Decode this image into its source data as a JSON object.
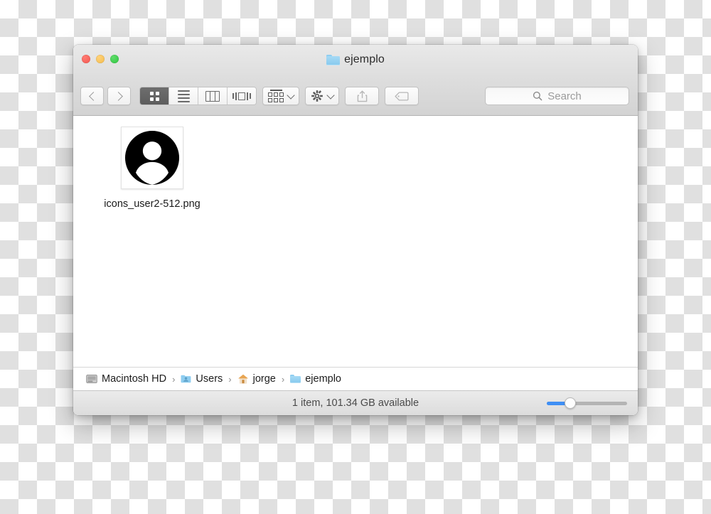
{
  "window": {
    "title": "ejemplo",
    "title_icon": "folder-icon",
    "traffic_lights": [
      {
        "name": "close",
        "label": "Close",
        "color": "#f35750"
      },
      {
        "name": "minimize",
        "label": "Minimize",
        "color": "#f3bb4b"
      },
      {
        "name": "maximize",
        "label": "Maximize",
        "color": "#2fc640"
      }
    ]
  },
  "toolbar": {
    "back_label": "Back",
    "back_icon": "chevron-left-icon",
    "forward_label": "Forward",
    "forward_icon": "chevron-right-icon",
    "view_modes": [
      {
        "name": "icon-view",
        "label": "Icon View",
        "icon": "grid-icon",
        "selected": true
      },
      {
        "name": "list-view",
        "label": "List View",
        "icon": "list-icon",
        "selected": false
      },
      {
        "name": "column-view",
        "label": "Column View",
        "icon": "columns-icon",
        "selected": false
      },
      {
        "name": "coverflow-view",
        "label": "Cover Flow View",
        "icon": "coverflow-icon",
        "selected": false
      }
    ],
    "arrange_label": "Arrange By",
    "arrange_icon": "arrange-grid-icon",
    "action_label": "Action",
    "action_icon": "gear-icon",
    "share_label": "Share",
    "share_icon": "share-icon",
    "tag_label": "Tags",
    "tag_icon": "tag-icon",
    "caret_icon": "chevron-down-icon"
  },
  "search": {
    "placeholder": "Search",
    "value": "",
    "icon": "search-icon"
  },
  "content": {
    "items": [
      {
        "name": "icons_user2-512.png",
        "icon": "user-avatar-icon",
        "selected": false
      }
    ]
  },
  "pathbar": {
    "crumbs": [
      {
        "label": "Macintosh HD",
        "icon": "hard-disk-icon"
      },
      {
        "label": "Users",
        "icon": "users-folder-icon"
      },
      {
        "label": "jorge",
        "icon": "home-icon"
      },
      {
        "label": "ejemplo",
        "icon": "folder-icon"
      }
    ],
    "separator": "›"
  },
  "statusbar": {
    "text": "1 item, 101.34 GB available",
    "item_count": 1,
    "available_space": "101.34 GB",
    "zoom_slider_value": 25,
    "zoom_accent_color": "#3f8ff5"
  }
}
